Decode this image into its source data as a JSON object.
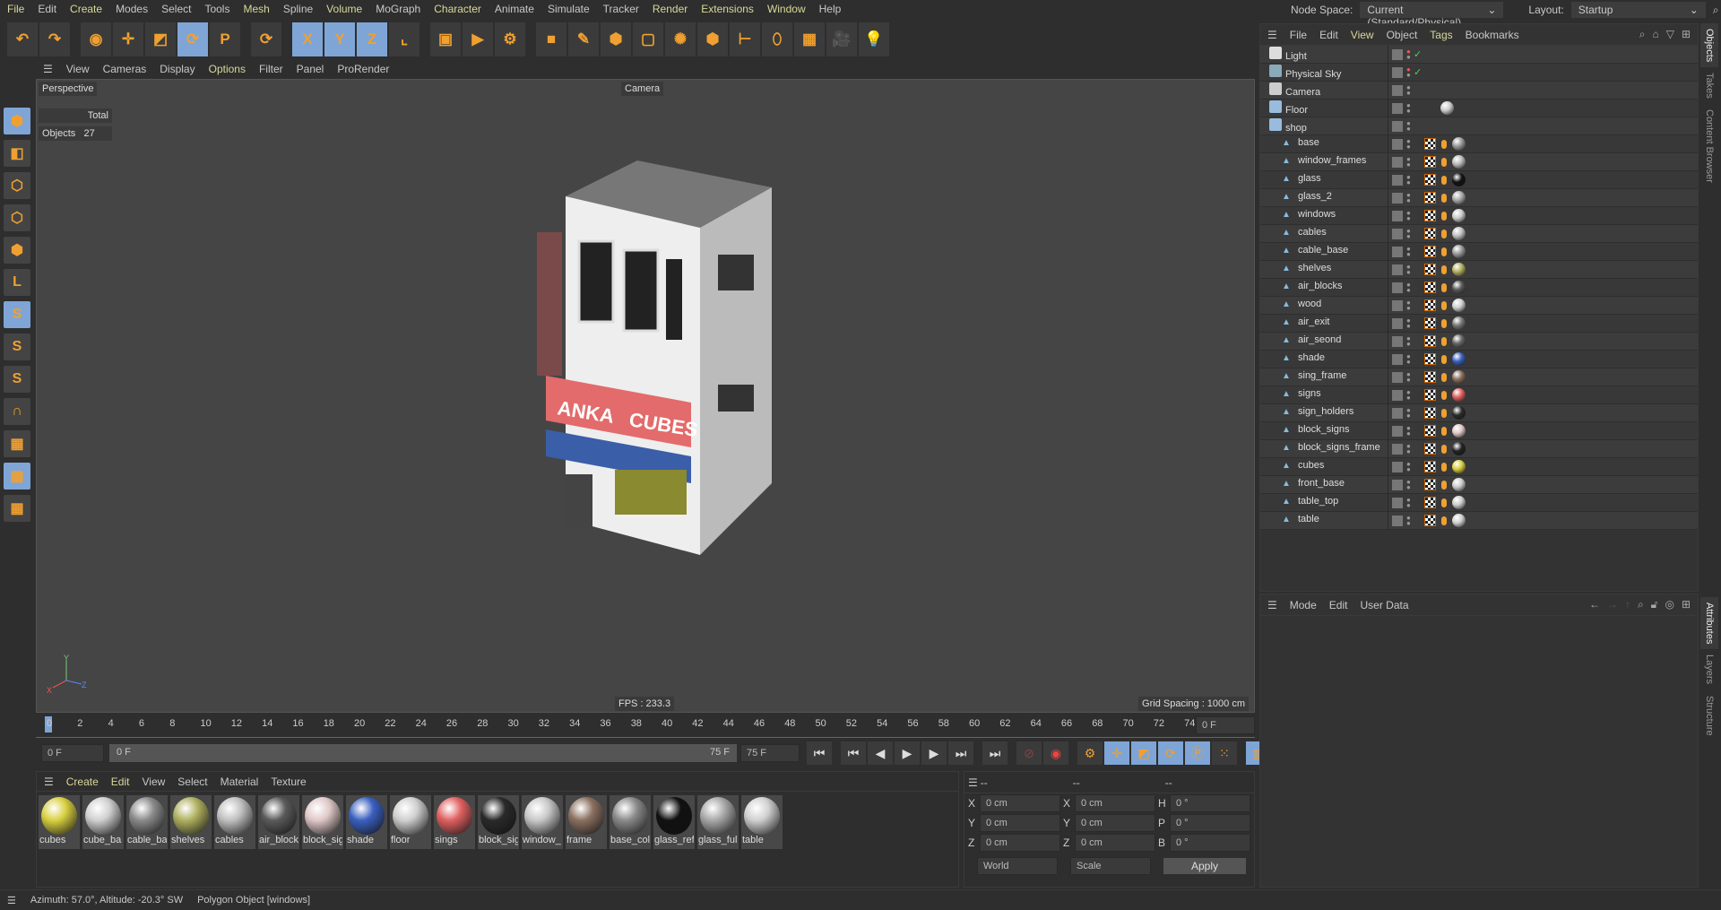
{
  "menu": [
    {
      "l": "File",
      "y": true
    },
    {
      "l": "Edit"
    },
    {
      "l": "Create",
      "y": true
    },
    {
      "l": "Modes"
    },
    {
      "l": "Select"
    },
    {
      "l": "Tools"
    },
    {
      "l": "Mesh",
      "y": true
    },
    {
      "l": "Spline"
    },
    {
      "l": "Volume",
      "y": true
    },
    {
      "l": "MoGraph"
    },
    {
      "l": "Character",
      "y": true
    },
    {
      "l": "Animate"
    },
    {
      "l": "Simulate"
    },
    {
      "l": "Tracker"
    },
    {
      "l": "Render",
      "y": true
    },
    {
      "l": "Extensions",
      "y": true
    },
    {
      "l": "Window",
      "y": true
    },
    {
      "l": "Help"
    }
  ],
  "toolbar": [
    {
      "i": "undo-icon",
      "g": "↶"
    },
    {
      "i": "redo-icon",
      "g": "↷"
    },
    {
      "gap": 1
    },
    {
      "i": "select-icon",
      "g": "◉"
    },
    {
      "i": "move-icon",
      "g": "✛"
    },
    {
      "i": "scale-icon",
      "g": "◩"
    },
    {
      "i": "rotate-icon",
      "g": "⟳",
      "sel": true
    },
    {
      "i": "psr-icon",
      "g": "P"
    },
    {
      "gap": 1
    },
    {
      "i": "recent-tool-icon",
      "g": "⟳"
    },
    {
      "gap": 1
    },
    {
      "i": "x-axis-icon",
      "g": "X",
      "sel": true
    },
    {
      "i": "y-axis-icon",
      "g": "Y",
      "sel": true
    },
    {
      "i": "z-axis-icon",
      "g": "Z",
      "sel": true
    },
    {
      "i": "coordinate-system-icon",
      "g": "⌞"
    },
    {
      "gap": 1
    },
    {
      "i": "render-view-icon",
      "g": "▣"
    },
    {
      "i": "render-picture-viewer-icon",
      "g": "▶"
    },
    {
      "i": "render-settings-icon",
      "g": "⚙"
    },
    {
      "gap": 1
    },
    {
      "i": "cube-icon",
      "g": "■"
    },
    {
      "i": "pen-icon",
      "g": "✎"
    },
    {
      "i": "subdivision-icon",
      "g": "⬢"
    },
    {
      "i": "extrude-icon",
      "g": "▢"
    },
    {
      "i": "cloner-icon",
      "g": "✺"
    },
    {
      "i": "mograph-icon",
      "g": "⬢"
    },
    {
      "i": "deformer-icon",
      "g": "⊢"
    },
    {
      "i": "field-icon",
      "g": "⬯"
    },
    {
      "i": "floor-icon",
      "g": "▦"
    },
    {
      "i": "camera-icon",
      "g": "🎥"
    },
    {
      "i": "light-icon",
      "g": "💡"
    }
  ],
  "left_tools": [
    {
      "i": "model-mode-icon",
      "g": "⬢",
      "sel": true
    },
    {
      "i": "texture-mode-icon",
      "g": "◧"
    },
    {
      "i": "points-mode-icon",
      "g": "⬡"
    },
    {
      "i": "edges-mode-icon",
      "g": "⬡"
    },
    {
      "i": "polygons-mode-icon",
      "g": "⬢"
    },
    {
      "i": "uv-mode-icon",
      "g": "L"
    },
    {
      "i": "snap-icon",
      "g": "S",
      "sel": true
    },
    {
      "i": "snap-settings-icon",
      "g": "S"
    },
    {
      "i": "snap-workplane-icon",
      "g": "S"
    },
    {
      "i": "magnet-icon",
      "g": "∩"
    },
    {
      "i": "workplane-icon",
      "g": "▦"
    },
    {
      "i": "locked-workplane-icon",
      "g": "▦",
      "sel": true
    },
    {
      "i": "workplane-rotate-icon",
      "g": "▦"
    }
  ],
  "viewport": {
    "menu": [
      "View",
      "Cameras",
      "Display",
      "Options",
      "Filter",
      "Panel",
      "ProRender"
    ],
    "active_menu": "Options",
    "name": "Perspective",
    "camera": "Camera",
    "stats_header": "Total",
    "stats_label": "Objects",
    "stats_value": "27",
    "fps": "FPS : 233.3",
    "grid": "Grid Spacing : 1000 cm",
    "sign_left": "ANKA",
    "sign_right": "CUBES"
  },
  "timeline": {
    "ticks": [
      "0",
      "2",
      "4",
      "6",
      "8",
      "10",
      "12",
      "14",
      "16",
      "18",
      "20",
      "22",
      "24",
      "26",
      "28",
      "30",
      "32",
      "34",
      "36",
      "38",
      "40",
      "42",
      "44",
      "46",
      "48",
      "50",
      "52",
      "54",
      "56",
      "58",
      "60",
      "62",
      "64",
      "66",
      "68",
      "70",
      "72",
      "74"
    ],
    "current": "0 F",
    "start": "0 F",
    "range_start": "0 F",
    "range_end": "75 F",
    "end": "75 F"
  },
  "materials": {
    "menu": [
      "Create",
      "Edit",
      "View",
      "Select",
      "Material",
      "Texture"
    ],
    "items": [
      {
        "n": "cubes",
        "c": "#d8d040"
      },
      {
        "n": "cube_ba",
        "c": "#d0d0d0"
      },
      {
        "n": "cable_ba",
        "c": "#8a8a8a"
      },
      {
        "n": "shelves",
        "c": "#b0b060"
      },
      {
        "n": "cables",
        "c": "#c0c0c0"
      },
      {
        "n": "air_block",
        "c": "#5a5a5a"
      },
      {
        "n": "block_sig",
        "c": "#e0c8c8"
      },
      {
        "n": "shade",
        "c": "#3a60c0"
      },
      {
        "n": "floor",
        "c": "#cfcfcf"
      },
      {
        "n": "sings",
        "c": "#e06060"
      },
      {
        "n": "block_sig",
        "c": "#2a2a2a"
      },
      {
        "n": "window_",
        "c": "#c8c8c8"
      },
      {
        "n": "frame",
        "c": "#8a7060"
      },
      {
        "n": "base_col",
        "c": "#8a8a8a"
      },
      {
        "n": "glass_ref",
        "c": "#111111"
      },
      {
        "n": "glass_ful",
        "c": "#a8a8a8"
      },
      {
        "n": "table",
        "c": "#d0d0d0"
      }
    ]
  },
  "coords": {
    "headers": [
      "--",
      "--",
      "--"
    ],
    "rows": [
      [
        "X",
        "0 cm",
        "X",
        "0 cm",
        "H",
        "0 °"
      ],
      [
        "Y",
        "0 cm",
        "Y",
        "0 cm",
        "P",
        "0 °"
      ],
      [
        "Z",
        "0 cm",
        "Z",
        "0 cm",
        "B",
        "0 °"
      ]
    ],
    "mode1": "World",
    "mode2": "Scale",
    "apply": "Apply"
  },
  "status": {
    "left": "Azimuth: 57.0°, Altitude: -20.3°  SW",
    "right": "Polygon Object [windows]"
  },
  "node_space": {
    "label": "Node Space:",
    "value": "Current (Standard/Physical)"
  },
  "layout": {
    "label": "Layout:",
    "value": "Startup"
  },
  "objects": {
    "menu": [
      {
        "l": "File"
      },
      {
        "l": "Edit"
      },
      {
        "l": "View",
        "y": true
      },
      {
        "l": "Object"
      },
      {
        "l": "Tags",
        "y": true
      },
      {
        "l": "Bookmarks"
      }
    ],
    "items": [
      {
        "n": "Light",
        "t": "light",
        "c": "#ddd",
        "check": true
      },
      {
        "n": "Physical Sky",
        "t": "sky",
        "c": "#8ab",
        "check": true
      },
      {
        "n": "Camera",
        "t": "camera",
        "c": "#ccc"
      },
      {
        "n": "Floor",
        "t": "floor",
        "c": "#9bd",
        "mat": "#cccccc"
      },
      {
        "n": "shop",
        "t": "null",
        "c": "#9bd"
      },
      {
        "n": "base",
        "child": true,
        "mat": "#999999"
      },
      {
        "n": "window_frames",
        "child": true,
        "mat": "#bbbbbb"
      },
      {
        "n": "glass",
        "child": true,
        "mat": "#111111"
      },
      {
        "n": "glass_2",
        "child": true,
        "mat": "#aaaaaa"
      },
      {
        "n": "windows",
        "child": true,
        "mat": "#cccccc"
      },
      {
        "n": "cables",
        "child": true,
        "mat": "#c0c0c0"
      },
      {
        "n": "cable_base",
        "child": true,
        "mat": "#999999"
      },
      {
        "n": "shelves",
        "child": true,
        "mat": "#b0b060"
      },
      {
        "n": "air_blocks",
        "child": true,
        "mat": "#5a5a5a"
      },
      {
        "n": "wood",
        "child": true,
        "mat": "#cfcfcf"
      },
      {
        "n": "air_exit",
        "child": true,
        "mat": "#777777"
      },
      {
        "n": "air_seond",
        "child": true,
        "mat": "#666666"
      },
      {
        "n": "shade",
        "child": true,
        "mat": "#3a60c0"
      },
      {
        "n": "sing_frame",
        "child": true,
        "mat": "#8a7060"
      },
      {
        "n": "signs",
        "child": true,
        "mat": "#e06060"
      },
      {
        "n": "sign_holders",
        "child": true,
        "mat": "#2a2a2a"
      },
      {
        "n": "block_signs",
        "child": true,
        "mat": "#e0c8c8"
      },
      {
        "n": "block_signs_frame",
        "child": true,
        "mat": "#222222"
      },
      {
        "n": "cubes",
        "child": true,
        "mat": "#d8d040"
      },
      {
        "n": "front_base",
        "child": true,
        "mat": "#cccccc"
      },
      {
        "n": "table_top",
        "child": true,
        "mat": "#cccccc"
      },
      {
        "n": "table",
        "child": true,
        "mat": "#d0d0d0"
      }
    ]
  },
  "attributes": {
    "menu": [
      "Mode",
      "Edit",
      "User Data"
    ]
  },
  "side_tabs_top": [
    "Objects",
    "Takes",
    "Content Browser"
  ],
  "side_tabs_bottom": [
    "Attributes",
    "Layers",
    "Structure"
  ]
}
